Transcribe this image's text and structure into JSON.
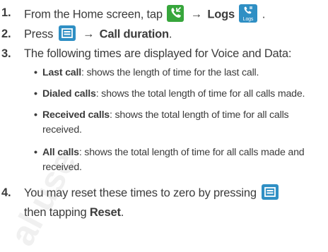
{
  "steps": [
    {
      "number": "1.",
      "prefix": "From the Home screen, tap",
      "arrow": "→",
      "target": "Logs",
      "suffix": "."
    },
    {
      "number": "2.",
      "prefix": "Press",
      "arrow": "→",
      "target": "Call duration",
      "suffix": "."
    },
    {
      "number": "3.",
      "text": "The following times are displayed for Voice and Data:"
    },
    {
      "number": "4.",
      "line1": "You may reset these times to zero by pressing",
      "line2_prefix": "then tapping",
      "line2_target": "Reset",
      "line2_suffix": "."
    }
  ],
  "bullets": [
    {
      "term": "Last call",
      "desc": ": shows the length of time for the last call."
    },
    {
      "term": "Dialed calls",
      "desc": ": shows the total length of time for all calls made."
    },
    {
      "term": "Received calls",
      "desc": ": shows the total length of time for all calls",
      "cont": "received."
    },
    {
      "term": "All calls",
      "desc": ": shows the total length of time for all calls made and",
      "cont": "received."
    }
  ],
  "bullet_symbol": "•",
  "icons": {
    "phone": "phone-icon",
    "logs": "logs-icon",
    "logs_label": "Logs",
    "menu": "menu-icon"
  },
  "colors": {
    "phone_icon": "#37a63c",
    "logs_icon": "#2f8fc4",
    "menu_icon": "#2f8fc4",
    "text": "#3c3c3c"
  }
}
